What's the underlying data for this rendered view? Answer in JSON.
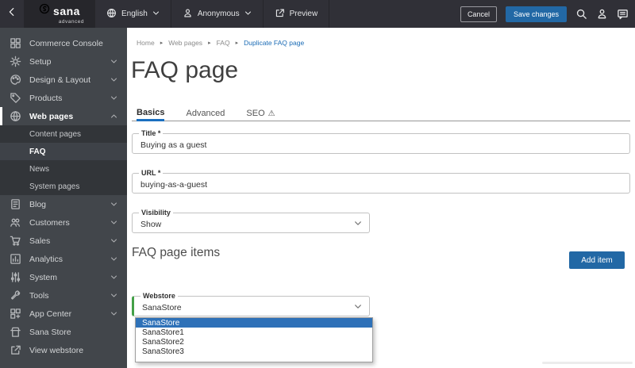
{
  "topbar": {
    "brand": "sana",
    "brand_sub": "advanced",
    "language": "English",
    "user": "Anonymous",
    "preview": "Preview",
    "cancel": "Cancel",
    "save": "Save changes"
  },
  "breadcrumb": {
    "items": [
      "Home",
      "Web pages",
      "FAQ"
    ],
    "current": "Duplicate FAQ page",
    "separator": "▸"
  },
  "sidebar": {
    "top": [
      {
        "label": "Commerce Console"
      },
      {
        "label": "Setup"
      },
      {
        "label": "Design & Layout"
      },
      {
        "label": "Products"
      },
      {
        "label": "Web pages"
      }
    ],
    "submenu": [
      "Content pages",
      "FAQ",
      "News",
      "System pages"
    ],
    "bottom": [
      {
        "label": "Blog"
      },
      {
        "label": "Customers"
      },
      {
        "label": "Sales"
      },
      {
        "label": "Analytics"
      },
      {
        "label": "System"
      },
      {
        "label": "Tools"
      },
      {
        "label": "App Center"
      },
      {
        "label": "Sana Store"
      },
      {
        "label": "View webstore"
      }
    ]
  },
  "page": {
    "title": "FAQ page"
  },
  "tabs": {
    "basics": "Basics",
    "advanced": "Advanced",
    "seo": "SEO",
    "seo_warning": "⚠"
  },
  "form": {
    "title": {
      "label": "Title *",
      "value": "Buying as a guest"
    },
    "url": {
      "label": "URL *",
      "value": "buying-as-a-guest"
    },
    "visibility": {
      "label": "Visibility",
      "value": "Show"
    }
  },
  "faq_items": {
    "heading": "FAQ page items",
    "add_button": "Add item"
  },
  "webstore": {
    "label": "Webstore",
    "value": "SanaStore",
    "options": [
      "SanaStore",
      "SanaStore1",
      "SanaStore2",
      "SanaStore3"
    ],
    "selected": "SanaStore"
  },
  "colors": {
    "accent_blue": "#2268a5",
    "selected_option_bg": "#2e71b8",
    "modified_green": "#43a047",
    "active_tab_underline": "#1a6fc0",
    "link_blue": "#1a6bb5"
  }
}
